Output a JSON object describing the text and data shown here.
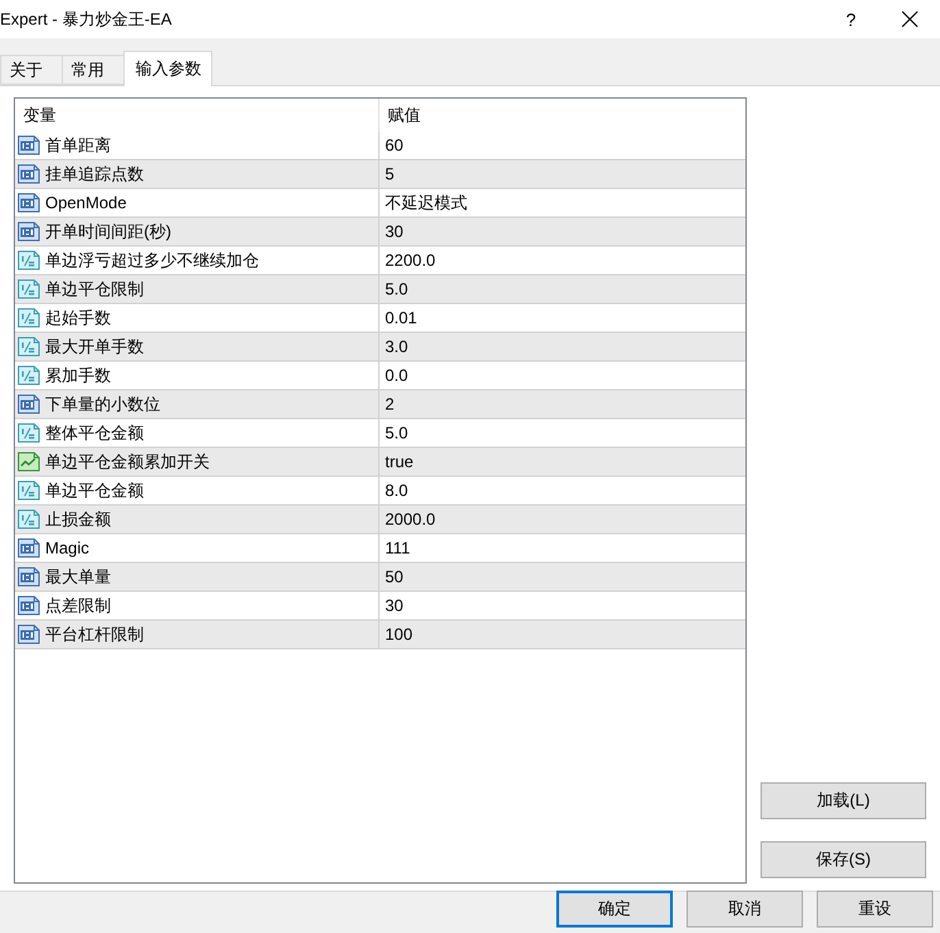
{
  "window": {
    "title": "Expert - 暴力炒金王-EA",
    "help": "?"
  },
  "tabs": [
    {
      "label": "关于",
      "selected": false
    },
    {
      "label": "常用",
      "selected": false
    },
    {
      "label": "输入参数",
      "selected": true
    }
  ],
  "table": {
    "columns": [
      "变量",
      "赋值"
    ],
    "rows": [
      {
        "kind": "int",
        "name": "首单距离",
        "value": "60"
      },
      {
        "kind": "int",
        "name": "挂单追踪点数",
        "value": "5"
      },
      {
        "kind": "int",
        "name": "OpenMode",
        "value": "不延迟模式"
      },
      {
        "kind": "int",
        "name": "开单时间间距(秒)",
        "value": "30"
      },
      {
        "kind": "double",
        "name": "单边浮亏超过多少不继续加仓",
        "value": "2200.0"
      },
      {
        "kind": "double",
        "name": "单边平仓限制",
        "value": "5.0"
      },
      {
        "kind": "double",
        "name": "起始手数",
        "value": "0.01"
      },
      {
        "kind": "double",
        "name": "最大开单手数",
        "value": "3.0"
      },
      {
        "kind": "double",
        "name": "累加手数",
        "value": "0.0"
      },
      {
        "kind": "int",
        "name": "下单量的小数位",
        "value": "2"
      },
      {
        "kind": "double",
        "name": "整体平仓金额",
        "value": "5.0"
      },
      {
        "kind": "bool",
        "name": "单边平仓金额累加开关",
        "value": "true"
      },
      {
        "kind": "double",
        "name": "单边平仓金额",
        "value": "8.0"
      },
      {
        "kind": "double",
        "name": "止损金额",
        "value": "2000.0"
      },
      {
        "kind": "int",
        "name": "Magic",
        "value": "111"
      },
      {
        "kind": "int",
        "name": "最大单量",
        "value": "50"
      },
      {
        "kind": "int",
        "name": "点差限制",
        "value": "30"
      },
      {
        "kind": "int",
        "name": "平台杠杆限制",
        "value": "100"
      }
    ]
  },
  "side_buttons": [
    {
      "label": "加载(L)"
    },
    {
      "label": "保存(S)"
    }
  ],
  "footer_buttons": [
    {
      "label": "确定",
      "default": true
    },
    {
      "label": "取消",
      "default": false
    },
    {
      "label": "重设",
      "default": false
    }
  ]
}
